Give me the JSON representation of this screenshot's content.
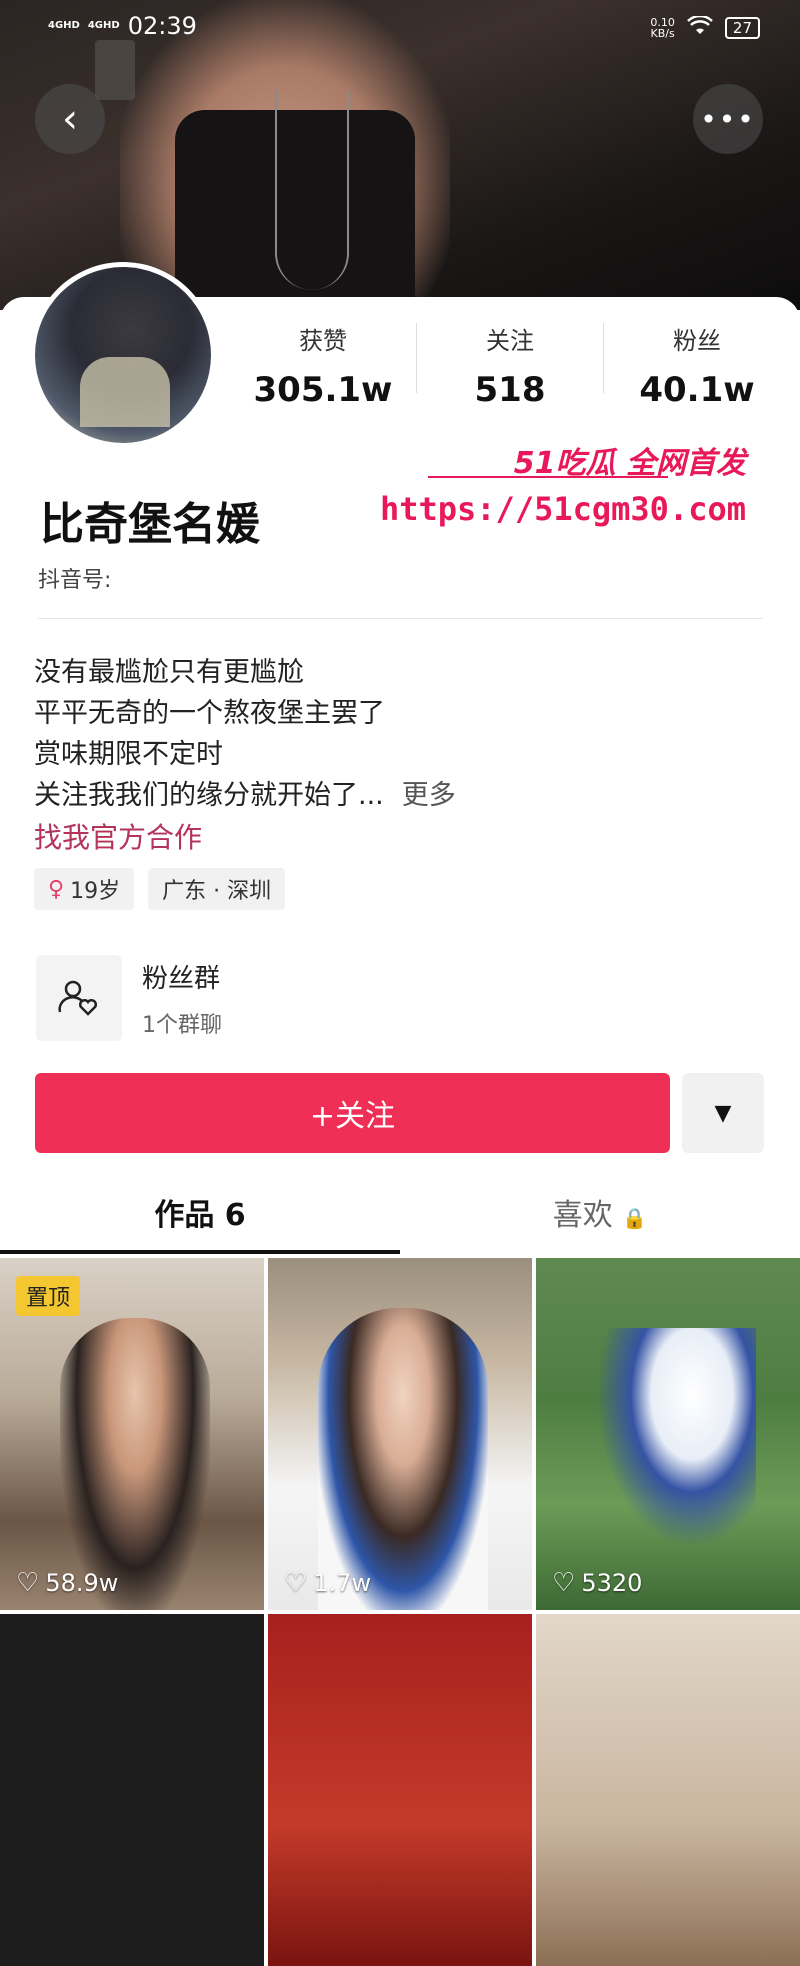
{
  "status_bar": {
    "signal1": "4GHD",
    "signal2": "4GHD",
    "time": "02:39",
    "net_speed": "0.10",
    "net_unit": "KB/s",
    "battery": "27"
  },
  "header": {
    "back_icon": "chevron-left-icon",
    "more_icon": "more-horizontal-icon"
  },
  "profile": {
    "stats": [
      {
        "label": "获赞",
        "value": "305.1w"
      },
      {
        "label": "关注",
        "value": "518"
      },
      {
        "label": "粉丝",
        "value": "40.1w"
      }
    ],
    "name": "比奇堡名媛",
    "douyin_id_label": "抖音号:",
    "bio_lines": [
      "没有最尴尬只有更尴尬",
      "平平无奇的一个熬夜堡主罢了",
      "赏味期限不定时",
      "关注我我们的缘分就开始了..."
    ],
    "bio_more": "更多",
    "cooperation": "找我官方合作",
    "tags": [
      {
        "icon": "female-icon",
        "text": "19岁"
      },
      {
        "text": "广东 · 深圳"
      }
    ]
  },
  "watermark": {
    "line1": "51吃瓜 全网首发",
    "line2": "https://51cgm30.com"
  },
  "fan_group": {
    "title": "粉丝群",
    "subtitle": "1个群聊",
    "icon": "users-heart-icon"
  },
  "actions": {
    "follow_label": "+关注",
    "dropdown_icon": "triangle-down-icon"
  },
  "tabs": {
    "works": "作品 6",
    "likes": "喜欢"
  },
  "videos": [
    {
      "pinned": "置顶",
      "likes": "58.9w"
    },
    {
      "likes": "1.7w"
    },
    {
      "likes": "5320"
    }
  ],
  "colors": {
    "accent": "#ef2f55",
    "link": "#b5325a",
    "pin": "#f4c730",
    "watermark": "#e8195a"
  }
}
